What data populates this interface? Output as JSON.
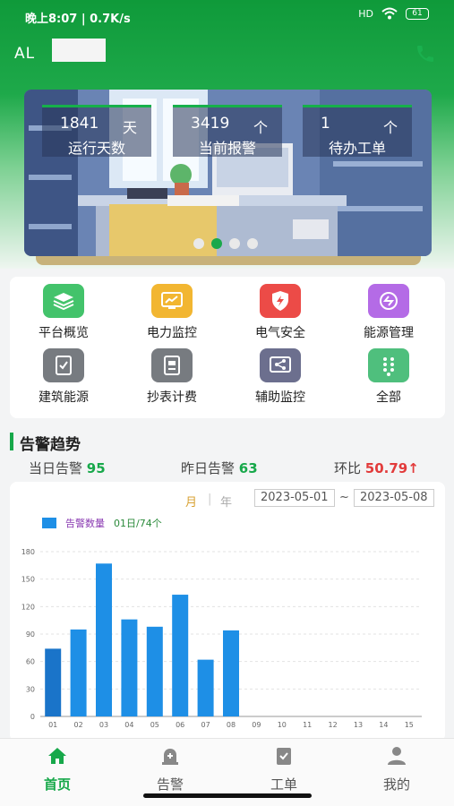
{
  "status_bar": {
    "time": "晚上8:07 | 0.7K/s",
    "right": "HD",
    "battery": "61"
  },
  "header": {
    "user_prefix": "AL",
    "phone_icon": "phone-icon"
  },
  "banner": {
    "stats": [
      {
        "value": "1841",
        "unit": "天",
        "label": "运行天数"
      },
      {
        "value": "3419",
        "unit": "个",
        "label": "当前报警"
      },
      {
        "value": "1",
        "unit": "个",
        "label": "待办工单"
      }
    ],
    "slides_total": 4,
    "active_slide": 2
  },
  "functions": [
    {
      "label": "平台概览",
      "icon": "layers-icon",
      "color": "#43c36b"
    },
    {
      "label": "电力监控",
      "icon": "monitor-chart-icon",
      "color": "#f2b631"
    },
    {
      "label": "电气安全",
      "icon": "shield-bolt-icon",
      "color": "#ec4b47"
    },
    {
      "label": "能源管理",
      "icon": "energy-cycle-icon",
      "color": "#b46be6"
    },
    {
      "label": "建筑能源",
      "icon": "tablet-check-icon",
      "color": "#777b80"
    },
    {
      "label": "抄表计费",
      "icon": "meter-icon",
      "color": "#777b80"
    },
    {
      "label": "辅助监控",
      "icon": "share-icon",
      "color": "#6c6f8e"
    },
    {
      "label": "全部",
      "icon": "keypad-icon",
      "color": "#4fbf7d"
    }
  ],
  "alarm_trend": {
    "title": "告警趋势",
    "today_label": "当日告警",
    "today_value": "95",
    "yesterday_label": "昨日告警",
    "yesterday_value": "63",
    "ratio_label": "环比",
    "ratio_value": "50.79↑"
  },
  "chart_controls": {
    "month": "月",
    "year": "年",
    "start_date": "2023-05-01",
    "end_date": "2023-05-08",
    "tilde": "~",
    "legend_label": "告警数量",
    "tooltip": "01日/74个"
  },
  "chart_data": {
    "type": "bar",
    "categories": [
      "01",
      "02",
      "03",
      "04",
      "05",
      "06",
      "07",
      "08",
      "09",
      "10",
      "11",
      "12",
      "13",
      "14",
      "15"
    ],
    "series": [
      {
        "name": "告警数量",
        "values": [
          74,
          95,
          167,
          106,
          98,
          133,
          62,
          94,
          null,
          null,
          null,
          null,
          null,
          null,
          null
        ]
      }
    ],
    "ylim": [
      0,
      180
    ],
    "yticks": [
      0,
      30,
      60,
      90,
      120,
      150,
      180
    ],
    "highlight_index": 0,
    "bar_color": "#1e8fe6",
    "highlight_color": "#1a74c9",
    "grid": true
  },
  "bottom_nav": [
    {
      "label": "首页",
      "icon": "home-icon",
      "active": true
    },
    {
      "label": "告警",
      "icon": "alarm-icon",
      "active": false
    },
    {
      "label": "工单",
      "icon": "work-order-icon",
      "active": false
    },
    {
      "label": "我的",
      "icon": "user-icon",
      "active": false
    }
  ],
  "colors": {
    "brand_green": "#17a84a",
    "ratio_red": "#e23b3b"
  }
}
